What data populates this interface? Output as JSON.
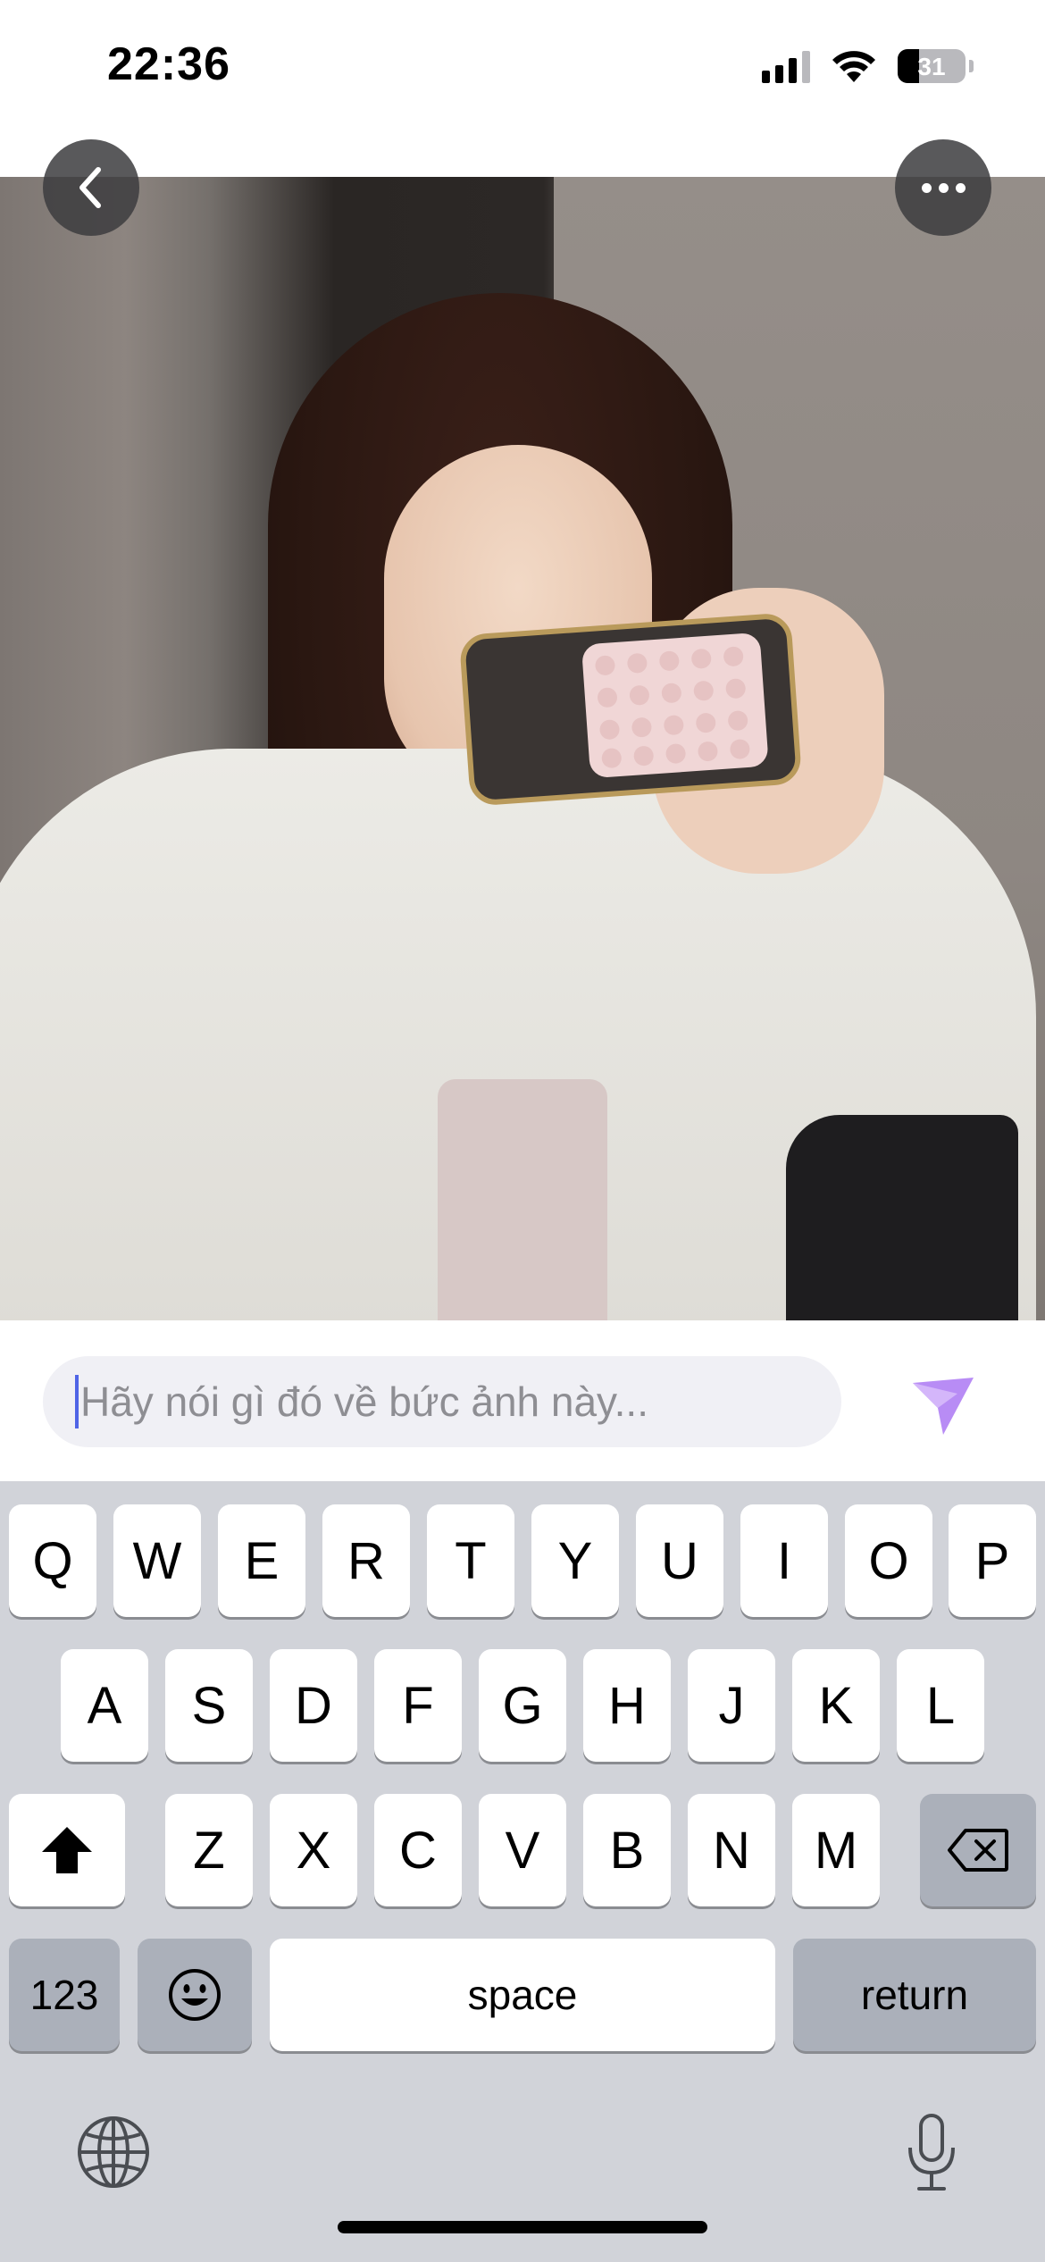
{
  "status_bar": {
    "time": "22:36",
    "battery_level": "31",
    "icons": [
      "cellular-signal-icon",
      "wifi-icon",
      "battery-icon"
    ]
  },
  "photo_viewer": {
    "back_icon": "chevron-left-icon",
    "more_icon": "ellipsis-icon"
  },
  "comment": {
    "placeholder": "Hãy nói gì đó về bức ảnh này...",
    "value": "",
    "send_icon": "send-icon",
    "accent_color": "#b88cf5"
  },
  "keyboard": {
    "row1": [
      "Q",
      "W",
      "E",
      "R",
      "T",
      "Y",
      "U",
      "I",
      "O",
      "P"
    ],
    "row2": [
      "A",
      "S",
      "D",
      "F",
      "G",
      "H",
      "J",
      "K",
      "L"
    ],
    "row3": [
      "Z",
      "X",
      "C",
      "V",
      "B",
      "N",
      "M"
    ],
    "numbers_label": "123",
    "space_label": "space",
    "return_label": "return",
    "icons": [
      "shift-icon",
      "backspace-icon",
      "emoji-icon",
      "globe-icon",
      "microphone-icon"
    ]
  }
}
